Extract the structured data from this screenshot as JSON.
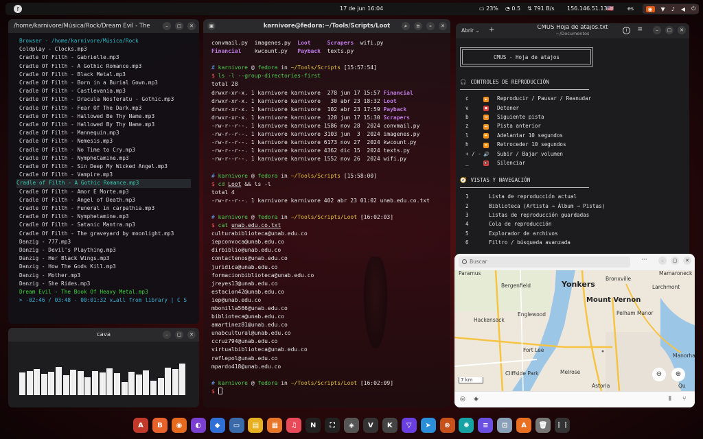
{
  "topbar": {
    "datetime": "17 de jun  16:04",
    "battery": "23%",
    "io": "0.5",
    "net": "791 B/s",
    "ip": "156.146.51.131",
    "flag": "🇺🇸",
    "lang": "es"
  },
  "music": {
    "title": "/home/karnivore/Música/Rock/Dream Evil - The Book O",
    "header": "Browser - /home/karnivore/Música/Rock",
    "tracks": [
      "Coldplay - Clocks.mp3",
      "Cradle Of Filth -  Gabrielle.mp3",
      "Cradle Of Filth - A Gothic Romance.mp3",
      "Cradle Of Filth - Black Metal.mp3",
      "Cradle Of Filth - Born in a Burial Gown.mp3",
      "Cradle Of Filth - Castlevania.mp3",
      "Cradle Of Filth - Dracula Nosferatu - Gothic.mp3",
      "Cradle Of Filth - Fear Of The Dark.mp3",
      "Cradle Of Filth - Hallowed Be Thy Name.mp3",
      "Cradle Of Filth - Hallowed By Thy Name.mp3",
      "Cradle Of Filth - Mannequin.mp3",
      "Cradle Of Filth - Nemesis.mp3",
      "Cradle Of Filth - No Time to Cry.mp3",
      "Cradle Of Filth - Nymphetamine.mp3",
      "Cradle Of Filth - Sin Deep My Wicked Angel.mp3",
      "Cradle Of Filth - Vampire.mp3",
      "Cradle of Filth - A Gothic Romance.mp3",
      "Cradle Of Filth - Amor E Morte.mp3",
      "Cradle Of Filth - Angel of Death.mp3",
      "Cradle Of Filth - Funeral in carpathia.mp3",
      "Cradle Of Filth - Nymphetamine.mp3",
      "Cradle Of Filth - Satanic Mantra.mp3",
      "Cradle Of Filth - The graveyard by moonlight.mp3",
      "Danzig - 777.mp3",
      "Danzig - Devil's Plaything.mp3",
      "Danzig - Her Black Wings.mp3",
      "Danzig - How The Gods Kill.mp3",
      "Danzig - Mother.mp3",
      "Danzig - She Rides.mp3"
    ],
    "playing": "Dream Evil - The Book Of Heavy Metal.mp3",
    "status": "> -02:46 / 03:48 - 00:01:32 v…all from library | C  S"
  },
  "cava": {
    "title": "cava",
    "levels": [
      0.72,
      0.76,
      0.83,
      0.68,
      0.74,
      0.89,
      0.62,
      0.81,
      0.77,
      0.56,
      0.75,
      0.71,
      0.84,
      0.69,
      0.41,
      0.73,
      0.66,
      0.79,
      0.46,
      0.55,
      0.86,
      0.83,
      1.0
    ]
  },
  "terminal": {
    "title": "karnivore@fedora:~/Tools/Scripts/Loot",
    "ls1": {
      "a": "convmail.py",
      "b": "imagenes.py",
      "c": "Loot",
      "d": "Scrapers",
      "e": "wifi.py",
      "f": "Financial",
      "g": "kwcount.py",
      "h": "Payback",
      "i": "texts.py"
    },
    "user": "karnivore",
    "at": "@",
    "host": "fedora",
    "in": "in",
    "path1": "~/Tools/Scripts",
    "time1": "[15:57:54]",
    "cmd1": "ls -l --group-directories-first",
    "total1": "total 28",
    "rows": [
      {
        "meta": "drwxr-xr-x. 1 karnivore karnivore  278 jun 17 15:57 ",
        "name": "Financial",
        "dir": true
      },
      {
        "meta": "drwxr-xr-x. 1 karnivore karnivore   30 abr 23 18:32 ",
        "name": "Loot",
        "dir": true
      },
      {
        "meta": "drwxr-xr-x. 1 karnivore karnivore  102 abr 23 17:59 ",
        "name": "Payback",
        "dir": true
      },
      {
        "meta": "drwxr-xr-x. 1 karnivore karnivore  128 jun 17 15:30 ",
        "name": "Scrapers",
        "dir": true
      },
      {
        "meta": "-rw-r--r--. 1 karnivore karnivore 1586 nov 28  2024 ",
        "name": "convmail.py",
        "dir": false
      },
      {
        "meta": "-rw-r--r--. 1 karnivore karnivore 3103 jun  3  2024 ",
        "name": "imagenes.py",
        "dir": false
      },
      {
        "meta": "-rw-r--r--. 1 karnivore karnivore 6173 nov 27  2024 ",
        "name": "kwcount.py",
        "dir": false
      },
      {
        "meta": "-rw-r--r--. 1 karnivore karnivore 4362 dic 15  2024 ",
        "name": "texts.py",
        "dir": false
      },
      {
        "meta": "-rw-r--r--. 1 karnivore karnivore 1552 nov 26  2024 ",
        "name": "wifi.py",
        "dir": false
      }
    ],
    "time2": "[15:58:00]",
    "cmd2a": "cd",
    "cmd2b": "Loot",
    "cmd2c": "&& ls -l",
    "total2": "total 4",
    "row2": "-rw-r--r--. 1 karnivore karnivore 402 abr 23 01:02 unab.edu.co.txt",
    "path2": "~/Tools/Scripts/Loot",
    "time3": "[16:02:03]",
    "cmd3a": "cat",
    "cmd3b": "unab.edu.co.txt",
    "emails": [
      "culturabiblioteca@unab.edu.co",
      "iepconvoca@unab.edu.co",
      "dirbiblio@unab.edu.co",
      "contactenos@unab.edu.co",
      "juridica@unab.edu.co",
      "formacionbiblioteca@unab.edu.co",
      "jreyes13@unab.edu.co",
      "estacion42@unab.edu.co",
      "iep@unab.edu.co",
      "mbonilla566@unab.edu.co",
      "biblioteca@unab.edu.co",
      "amartinez81@unab.edu.co",
      "unabcultural@unab.edu.co",
      "ccruz794@unab.edu.co",
      "virtualbiblioteca@unab.edu.co",
      "reflepol@unab.edu.co",
      "mpardo418@unab.edu.co"
    ],
    "time4": "[16:02:09]",
    "prompt": "$"
  },
  "editor": {
    "open": "Abrir",
    "plus": "+",
    "title": "CMUS Hoja de atajos.txt",
    "subtitle": "~/Documentos",
    "heading": "CMUS - Hoja de atajos",
    "section1": "CONTROLES DE REPRODUCCIÓN",
    "controls": [
      {
        "k": "c",
        "icon": "▶",
        "cls": "o",
        "d": "Reproducir / Pausar / Reanudar"
      },
      {
        "k": "v",
        "icon": "■",
        "cls": "r",
        "d": "Detener"
      },
      {
        "k": "b",
        "icon": "⏭",
        "cls": "o",
        "d": "Siguiente pista"
      },
      {
        "k": "z",
        "icon": "⏮",
        "cls": "o",
        "d": "Pista anterior"
      },
      {
        "k": "l",
        "icon": "⏩",
        "cls": "o",
        "d": "Adelantar 10 segundos"
      },
      {
        "k": "h",
        "icon": "⏪",
        "cls": "o",
        "d": "Retroceder 10 segundos"
      },
      {
        "k": "+ / -",
        "icon": "🔊",
        "cls": "s",
        "d": "Subir / Bajar volumen"
      },
      {
        "k": "_",
        "icon": "🔇",
        "cls": "r",
        "d": "Silenciar"
      }
    ],
    "section2": "VISTAS Y NAVEGACIÓN",
    "views": [
      {
        "k": "1",
        "d": "Lista de reproducción actual"
      },
      {
        "k": "2",
        "d": "Biblioteca (Artista → Álbum → Pistas)"
      },
      {
        "k": "3",
        "d": "Listas de reproducción guardadas"
      },
      {
        "k": "4",
        "d": "Cola de reproducción"
      },
      {
        "k": "5",
        "d": "Explorador de archivos"
      },
      {
        "k": "6",
        "d": "Filtro / búsqueda avanzada"
      }
    ]
  },
  "maps": {
    "search_placeholder": "Buscar",
    "scale": "7 km",
    "labels": {
      "paramus": "Paramus",
      "bergenfield": "Bergenfield",
      "yonkers": "Yonkers",
      "bronxville": "Bronxville",
      "mamaroneck": "Mamaroneck",
      "larchmont": "Larchmont",
      "mountvernon": "Mount Vernon",
      "hackensack": "Hackensack",
      "englewood": "Englewood",
      "pelham": "Pelham Manor",
      "fortlee": "Fort Lee",
      "cliffside": "Cliffside Park",
      "melrose": "Melrose",
      "astoria": "Astoria",
      "manorha": "Manorha",
      "qu": "Qu"
    }
  },
  "dock": {
    "items": [
      "A",
      "B",
      "◉",
      "◐",
      "◆",
      "▭",
      "▤",
      "▦",
      "♫",
      "N",
      "⛶",
      "◈",
      "V",
      "K",
      "▽",
      "➤",
      "⊗",
      "✺",
      "≡",
      "⊡",
      "A",
      "🗑",
      "⋮⋮"
    ]
  }
}
